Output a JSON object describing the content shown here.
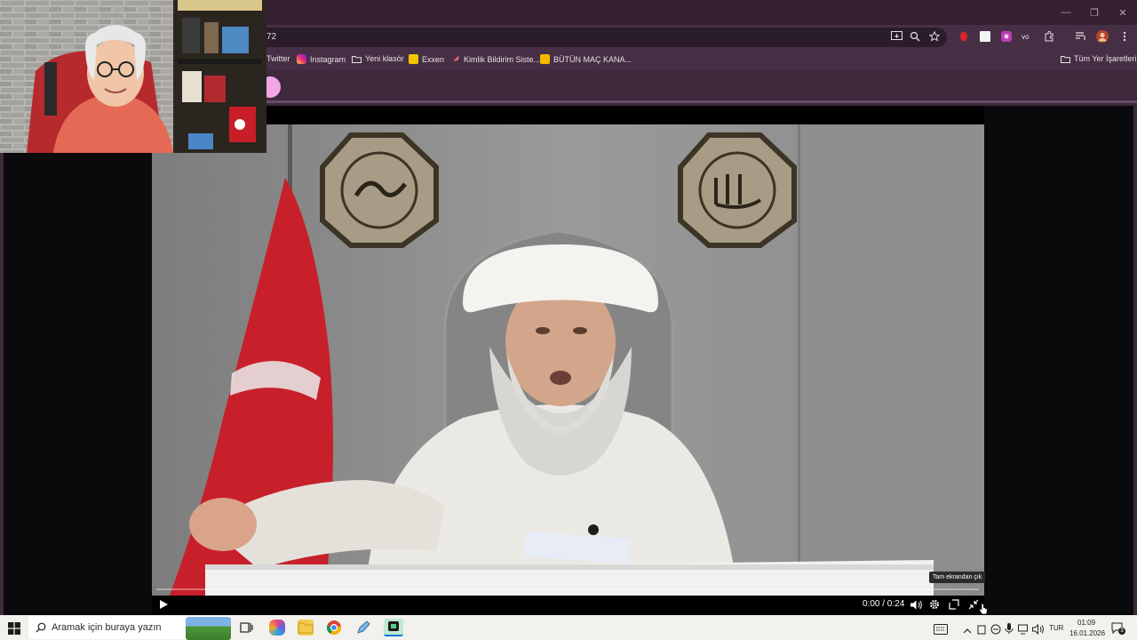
{
  "browser": {
    "url_fragment": "72",
    "bookmarks": [
      {
        "label": "Twitter",
        "icon": "twitter-icon",
        "color": "#1d9bf0"
      },
      {
        "label": "Instagram",
        "icon": "instagram-icon",
        "color": "#d6249f"
      },
      {
        "label": "Yeni klasör",
        "icon": "folder-icon",
        "color": "#eadfe9"
      },
      {
        "label": "Exxen",
        "icon": "exxen-icon",
        "color": "#f5c400"
      },
      {
        "label": "Kimlik Bildirim Siste...",
        "icon": "feather-icon",
        "color": "#e86a6a"
      },
      {
        "label": "BÜTÜN MAÇ KANA...",
        "icon": "jp-icon",
        "color": "#f5b800"
      }
    ],
    "all_bookmarks_label": "Tüm Yer İşaretleri",
    "window_controls": {
      "minimize": "—",
      "restore": "❐",
      "close": "✕"
    }
  },
  "video": {
    "time_display": "0:00 / 0:24",
    "tooltip": "Tam ekrandan çık",
    "progress": 0
  },
  "taskbar": {
    "search_placeholder": "Aramak için buraya yazın",
    "language": "TUR",
    "time": "01:09",
    "date": "16.01.2026",
    "notification_count": "3"
  },
  "colors": {
    "titlebar": "#351f33",
    "toolbar": "#462f44",
    "accent": "#f3a6e6",
    "flag_red": "#c8202a"
  }
}
